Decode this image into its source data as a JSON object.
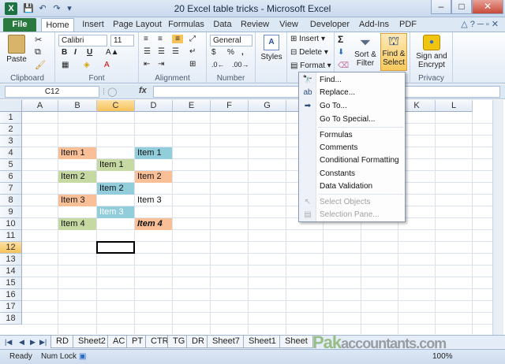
{
  "window": {
    "title": "20 Excel table tricks - Microsoft Excel",
    "app_icon": "X",
    "minimize": "–",
    "maximize": "□",
    "close": "✕"
  },
  "qat": {
    "save_icon": "💾",
    "undo_icon": "↶",
    "redo_icon": "↷",
    "customize_icon": "▾"
  },
  "tabs": {
    "file": "File",
    "items": [
      "Home",
      "Insert",
      "Page Layout",
      "Formulas",
      "Data",
      "Review",
      "View",
      "Developer",
      "Add-Ins",
      "PDF"
    ],
    "active": "Home"
  },
  "ribbon": {
    "clipboard": {
      "label": "Clipboard",
      "paste": "Paste"
    },
    "font": {
      "label": "Font",
      "name": "Calibri",
      "size": "11",
      "bold": "B",
      "italic": "I",
      "underline": "U"
    },
    "alignment": {
      "label": "Alignment"
    },
    "number": {
      "label": "Number",
      "format": "General",
      "currency": "$",
      "percent": "%",
      "comma": ","
    },
    "styles": {
      "label": "Styles",
      "button": "Styles"
    },
    "cells": {
      "insert": "Insert",
      "delete": "Delete",
      "format": "Format"
    },
    "editing": {
      "sum": "Σ",
      "sort_filter": "Sort &",
      "sort_filter2": "Filter",
      "find_select": "Find &",
      "find_select2": "Select"
    },
    "privacy": {
      "label": "Privacy",
      "sign": "Sign and",
      "sign2": "Encrypt"
    }
  },
  "formula_bar": {
    "name_box": "C12",
    "fx": "fx",
    "value": ""
  },
  "columns": [
    "A",
    "B",
    "C",
    "D",
    "E",
    "F",
    "G",
    "H",
    "I",
    "J",
    "K",
    "L"
  ],
  "rows": [
    "1",
    "2",
    "3",
    "4",
    "5",
    "6",
    "7",
    "8",
    "9",
    "10",
    "11",
    "12",
    "13",
    "14",
    "15",
    "16",
    "17",
    "18"
  ],
  "selected": {
    "column": "C",
    "row": "12"
  },
  "cells": {
    "B4": "Item 1",
    "D4": "Item 1",
    "C5": "Item 1",
    "B6": "Item 2",
    "D6": "Item 2",
    "C7": "Item 2",
    "B8": "Item 3",
    "D8": "Item 3",
    "C9": "Item 3",
    "B10": "Item 4",
    "D10": "Item 4"
  },
  "colors": {
    "orange": "#f9c097",
    "green": "#c7d9a3",
    "blue": "#92cddc",
    "bold_orange": "#f9c097"
  },
  "menu": {
    "items": [
      {
        "label": "Find...",
        "icon": "binoculars-icon",
        "glyph": "🔭"
      },
      {
        "label": "Replace...",
        "icon": "replace-icon",
        "glyph": "ab"
      },
      {
        "label": "Go To...",
        "icon": "arrow-right-icon",
        "glyph": "➡"
      },
      {
        "label": "Go To Special...",
        "icon": "",
        "glyph": ""
      },
      {
        "label": "Formulas",
        "icon": "",
        "glyph": ""
      },
      {
        "label": "Comments",
        "icon": "",
        "glyph": ""
      },
      {
        "label": "Conditional Formatting",
        "icon": "",
        "glyph": ""
      },
      {
        "label": "Constants",
        "icon": "",
        "glyph": ""
      },
      {
        "label": "Data Validation",
        "icon": "",
        "glyph": ""
      },
      {
        "label": "Select Objects",
        "icon": "cursor-icon",
        "glyph": "↖",
        "disabled": true
      },
      {
        "label": "Selection Pane...",
        "icon": "pane-icon",
        "glyph": "▤",
        "disabled": true
      }
    ]
  },
  "sheets": [
    "RD",
    "Sheet2",
    "AC",
    "PT",
    "CTR",
    "TG",
    "DR",
    "Sheet7",
    "Sheet1",
    "Sheet"
  ],
  "status": {
    "ready": "Ready",
    "num_lock": "Num Lock",
    "zoom": "100%"
  },
  "watermark": {
    "pak": "Pak",
    "rest": "accountants.com"
  }
}
